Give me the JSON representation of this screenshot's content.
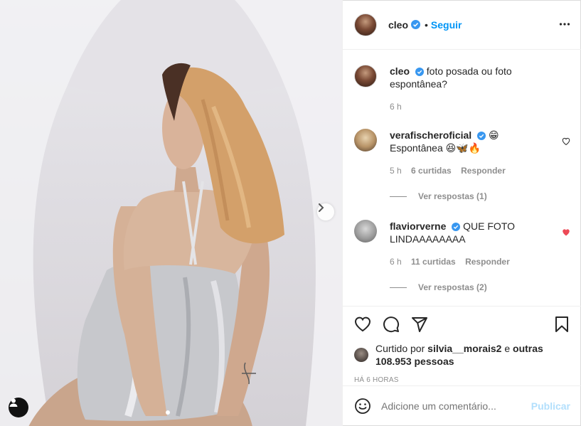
{
  "post": {
    "author": "cleo",
    "follow_label": "Seguir",
    "separator": "•"
  },
  "caption": {
    "username": "cleo",
    "text": "foto posada ou foto espontânea?",
    "time": "6 h"
  },
  "comments": [
    {
      "username": "verafischeroficial",
      "emoji_after_name": "😁",
      "text": "Espontânea 😆🦋🔥",
      "time": "5 h",
      "likes": "6 curtidas",
      "reply_label": "Responder",
      "view_replies": "Ver respostas (1)",
      "liked": false
    },
    {
      "username": "flaviorverne",
      "text": "QUE FOTO LINDAAAAAAAA",
      "time": "6 h",
      "likes": "11 curtidas",
      "reply_label": "Responder",
      "view_replies": "Ver respostas (2)",
      "liked": true
    }
  ],
  "likes": {
    "prefix": "Curtido por",
    "user": "silvia__morais2",
    "connector": "e",
    "others": "outras 108.953 pessoas"
  },
  "timestamp": "HÁ 6 HORAS",
  "add_comment": {
    "placeholder": "Adicione um comentário...",
    "publish_label": "Publicar"
  },
  "colors": {
    "accent": "#0095f6",
    "like_red": "#ed4956",
    "verified_blue": "#3897f0",
    "publish_disabled": "#b2dffc"
  },
  "icons": [
    "heart-icon",
    "comment-icon",
    "share-icon",
    "save-icon",
    "more-icon",
    "emoji-icon",
    "chevron-right-icon",
    "user-tag-icon",
    "verified-icon"
  ]
}
